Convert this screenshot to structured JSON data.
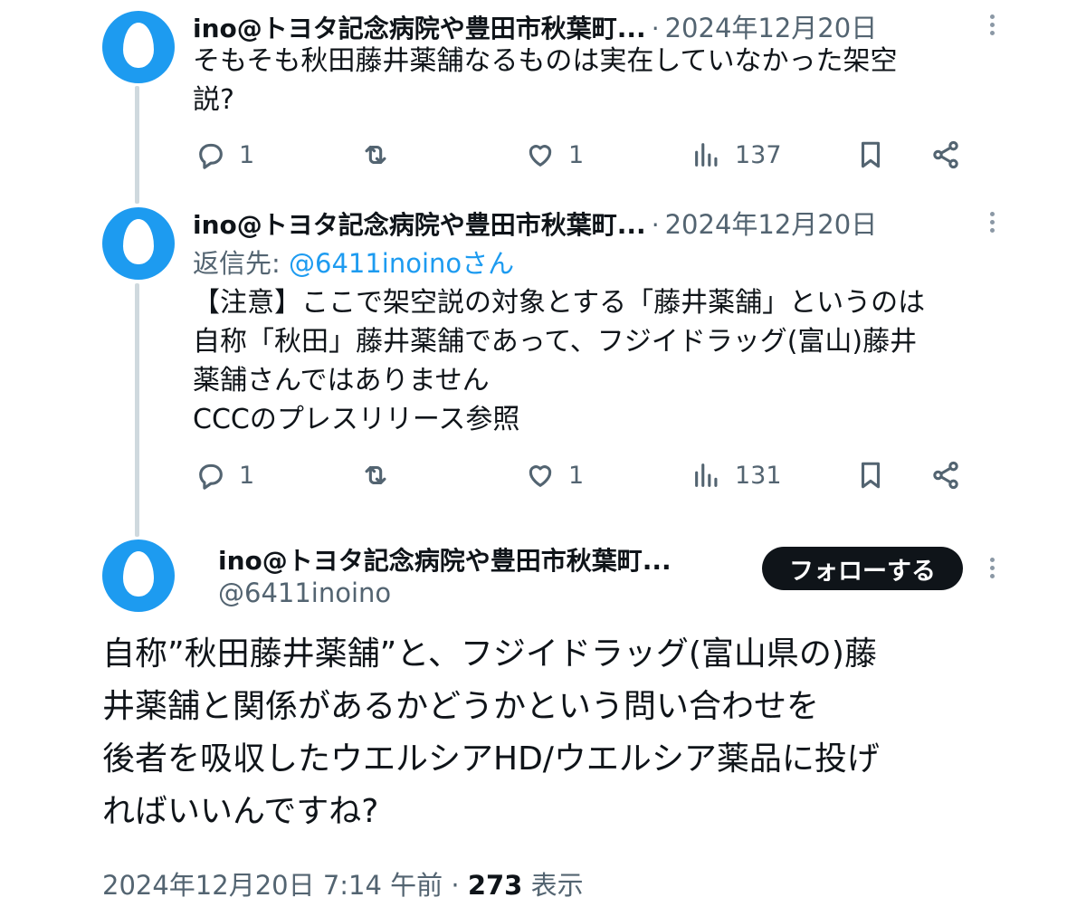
{
  "tweets": [
    {
      "author_name": "ino@トヨタ記念病院や豊田市秋葉町...",
      "separator": "·",
      "date": "2024年12月20日",
      "text": "そもそも秋田藤井薬舗なるものは実在していなかった架空\n説?",
      "actions": {
        "replies": "1",
        "likes": "1",
        "views": "137"
      }
    },
    {
      "author_name": "ino@トヨタ記念病院や豊田市秋葉町...",
      "separator": "·",
      "date": "2024年12月20日",
      "reply_to_label": "返信先: ",
      "reply_to_handle": "@6411inoinoさん",
      "text": "【注意】ここで架空説の対象とする「藤井薬舗」というのは\n自称「秋田」藤井薬舗であって、フジイドラッグ(富山)藤井\n薬舗さんではありません\nCCCのプレスリリース参照",
      "actions": {
        "replies": "1",
        "likes": "1",
        "views": "131"
      }
    }
  ],
  "main_tweet": {
    "author_name": "ino@トヨタ記念病院や豊田市秋葉町...",
    "handle": "@6411inoino",
    "follow_label": "フォローする",
    "text": "自称”秋田藤井薬舗”と、フジイドラッグ(富山県の)藤\n井薬舗と関係があるかどうかという問い合わせを\n後者を吸収したウエルシアHD/ウエルシア薬品に投げ\nればいいんですね?",
    "timestamp": "2024年12月20日 7:14 午前",
    "separator": "·",
    "view_count": "273",
    "view_label": "表示"
  },
  "colors": {
    "avatar": "#1d9bf0",
    "link": "#1d9bf0",
    "secondary_text": "#536471",
    "thread_line": "#cfd9de",
    "follow_button": "#0f1419"
  },
  "icons": [
    "reply-icon",
    "retweet-icon",
    "like-icon",
    "views-icon",
    "bookmark-icon",
    "share-icon",
    "more-icon",
    "default-egg-avatar"
  ]
}
